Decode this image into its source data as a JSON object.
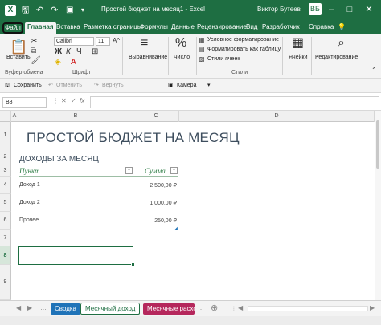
{
  "titlebar": {
    "title": "Простой бюджет на месяц1  -  Excel",
    "user": "Виктор Бутеев",
    "icons": [
      "excel-icon",
      "save-icon",
      "undo-icon",
      "redo-icon",
      "camera-icon",
      "more-icon",
      "minimize-icon",
      "restore-icon",
      "close-icon"
    ]
  },
  "tabs": {
    "file": "Файл",
    "items": [
      "Главная",
      "Вставка",
      "Разметка страницы",
      "Формулы",
      "Данные",
      "Рецензирование",
      "Вид",
      "Разработчик",
      "Справка"
    ],
    "active": "Главная"
  },
  "ribbon": {
    "paste": "Вставить",
    "clipboard": "Буфер обмена",
    "font_name": "Calibri",
    "font_size": "11",
    "font_group": "Шрифт",
    "alignment": "Выравнивание",
    "number": "Число",
    "cond_format": "Условное форматирование",
    "format_table": "Форматировать как таблицу",
    "cell_styles": "Стили ячеек",
    "styles_group": "Стили",
    "cells": "Ячейки",
    "editing": "Редактирование"
  },
  "quickbar": {
    "save": "Сохранить",
    "undo": "Отменить",
    "redo": "Вернуть",
    "camera": "Камера"
  },
  "formula": {
    "namebox": "B8",
    "cancel": "✕",
    "enter": "✓",
    "fx": "fx"
  },
  "grid": {
    "columns": [
      "A",
      "B",
      "C",
      "D"
    ],
    "rows": [
      "1",
      "2",
      "3",
      "4",
      "5",
      "6",
      "7",
      "8",
      "9"
    ],
    "selected_row": "8"
  },
  "sheet": {
    "title": "ПРОСТОЙ БЮДЖЕТ НА МЕСЯЦ",
    "subtitle": "ДОХОДЫ ЗА МЕСЯЦ",
    "col_item": "Пункт",
    "col_amount": "Сумма",
    "rows": [
      {
        "label": "Доход 1",
        "value": "2 500,00 ₽"
      },
      {
        "label": "Доход 2",
        "value": "1 000,00 ₽"
      },
      {
        "label": "Прочее",
        "value": "250,00 ₽"
      }
    ]
  },
  "sheettabs": [
    "Сводка",
    "Месячный доход",
    "Месячные расходы"
  ]
}
